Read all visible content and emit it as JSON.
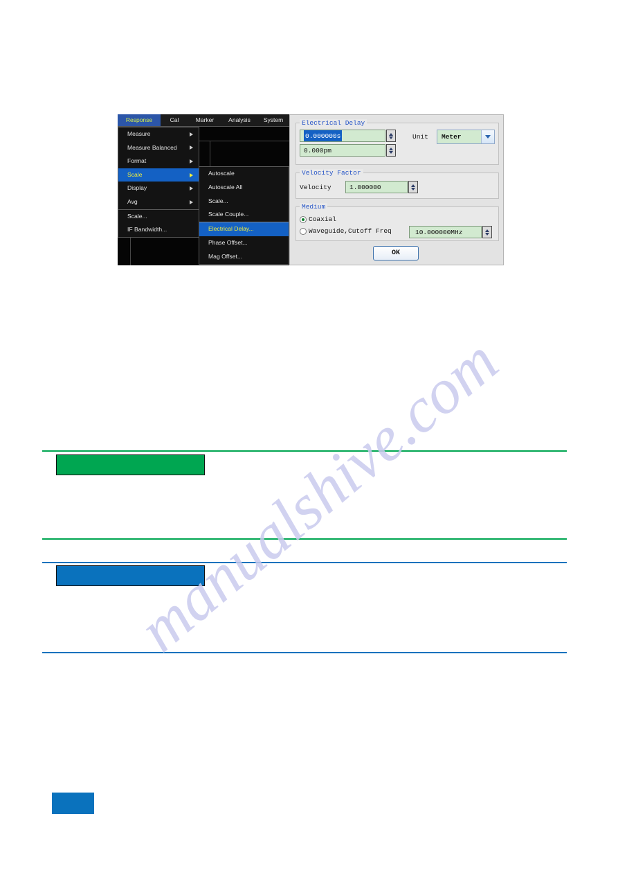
{
  "screenshot": {
    "menubar": {
      "items": [
        {
          "label": "Response",
          "active": true
        },
        {
          "label": "Cal",
          "active": false
        },
        {
          "label": "Marker",
          "active": false
        },
        {
          "label": "Analysis",
          "active": false
        },
        {
          "label": "System",
          "active": false
        }
      ]
    },
    "response_menu": {
      "items": [
        {
          "label": "Measure",
          "submenu": true,
          "selected": false
        },
        {
          "label": "Measure Balanced",
          "submenu": true,
          "selected": false
        },
        {
          "label": "Format",
          "submenu": true,
          "selected": false
        },
        {
          "label": "Scale",
          "submenu": true,
          "selected": true
        },
        {
          "label": "Display",
          "submenu": true,
          "selected": false
        },
        {
          "label": "Avg",
          "submenu": true,
          "selected": false
        },
        {
          "label": "Scale...",
          "submenu": false,
          "selected": false
        },
        {
          "label": "IF Bandwidth...",
          "submenu": false,
          "selected": false
        }
      ]
    },
    "scale_submenu": {
      "items": [
        {
          "label": "Autoscale",
          "selected": false
        },
        {
          "label": "Autoscale All",
          "selected": false
        },
        {
          "label": "Scale...",
          "selected": false
        },
        {
          "label": "Scale Couple...",
          "selected": false
        },
        {
          "label": "Electrical Delay...",
          "selected": true
        },
        {
          "label": "Phase Offset...",
          "selected": false
        },
        {
          "label": "Mag Offset...",
          "selected": false
        }
      ]
    },
    "dialog": {
      "electrical_delay": {
        "group_title": "Electrical Delay",
        "delay_time_value": "0.000000s",
        "delay_distance_value": "0.000pm",
        "unit_label": "Unit",
        "unit_value": "Meter"
      },
      "velocity_factor": {
        "group_title": "Velocity Factor",
        "velocity_label": "Velocity",
        "velocity_value": "1.000000"
      },
      "medium": {
        "group_title": "Medium",
        "coaxial_label": "Coaxial",
        "coaxial_selected": true,
        "waveguide_label": "Waveguide,Cutoff Freq",
        "waveguide_selected": false,
        "cutoff_freq_value": "10.000000MHz"
      },
      "ok_label": "OK"
    }
  },
  "page": {
    "section_green": {
      "heading": "",
      "body": ""
    },
    "section_blue": {
      "heading": "",
      "body": ""
    },
    "page_number": ""
  },
  "colors": {
    "accent_green": "#00a651",
    "accent_blue": "#0a72bd",
    "menu_highlight": "#1461c4",
    "menu_highlight_text": "#f2ef3b",
    "dialog_field_bg": "#d2ead0",
    "dialog_group_title": "#2554c7"
  },
  "watermark": {
    "text": "manualshive.com"
  }
}
